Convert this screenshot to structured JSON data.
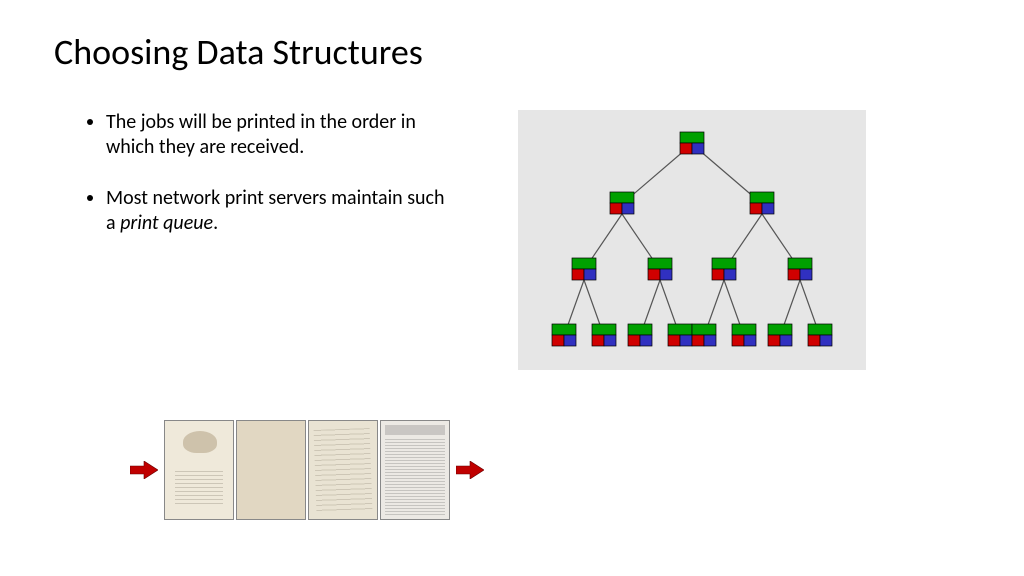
{
  "title": "Choosing Data Structures",
  "bullets": [
    {
      "pre": "The jobs will be printed in the order in which they are received.",
      "italic": "",
      "post": ""
    },
    {
      "pre": "Most network print servers maintain such a ",
      "italic": "print queue",
      "post": "."
    }
  ],
  "tree": {
    "levels": 4,
    "node_colors": {
      "top": "#00a000",
      "bottom_left": "#d00000",
      "bottom_right": "#3030c0"
    }
  },
  "queue": {
    "arrow_color": "#c00000",
    "doc_count": 4
  }
}
